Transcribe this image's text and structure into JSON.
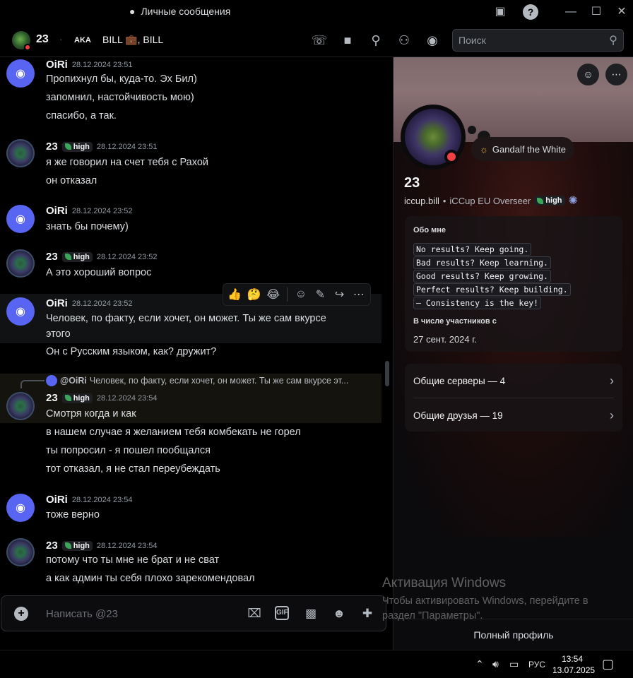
{
  "window": {
    "title": "Личные сообщения"
  },
  "header": {
    "name": "23",
    "aka_label": "AKA",
    "nicknames": "BILL 💼, BILL"
  },
  "search": {
    "placeholder": "Поиск"
  },
  "messages": [
    {
      "author": "OiRi",
      "time": "28.12.2024 23:51",
      "lines": [
        "Пропихнул бы, куда-то. Эх Бил)",
        "запомнил, настойчивость мою)",
        "спасибо, а так."
      ]
    },
    {
      "author": "23",
      "tag": "high",
      "time": "28.12.2024 23:51",
      "lines": [
        "я же говорил на счет тебя с Рахой",
        "он отказал"
      ]
    },
    {
      "author": "OiRi",
      "time": "28.12.2024 23:52",
      "lines": [
        "знать бы почему)"
      ]
    },
    {
      "author": "23",
      "tag": "high",
      "time": "28.12.2024 23:52",
      "lines": [
        "А это хороший вопрос"
      ]
    },
    {
      "author": "OiRi",
      "time": "28.12.2024 23:52",
      "lines": [
        "Человек, по факту, если хочет, он может. Ты же сам вкурсе",
        "этого",
        "Он с Русским языком, как? дружит?"
      ]
    },
    {
      "author": "23",
      "tag": "high",
      "time": "28.12.2024 23:54",
      "reply_to": "@OiRi",
      "reply_text": "Человек, по факту, если хочет, он может. Ты же сам вкурсе эт...",
      "lines": [
        "Смотря когда и как",
        "в нашем случае я желанием тебя комбекать не горел",
        "ты попросил - я пошел пообщался",
        "тот отказал, я не стал переубеждать"
      ]
    },
    {
      "author": "OiRi",
      "time": "28.12.2024 23:54",
      "lines": [
        "тоже верно"
      ]
    },
    {
      "author": "23",
      "tag": "high",
      "time": "28.12.2024 23:54",
      "lines": [
        "потому что ты мне не брат и не сват",
        "а как админ ты себя плохо зарекомендовал"
      ]
    }
  ],
  "composer": {
    "placeholder": "Написать @23"
  },
  "profile": {
    "status": "Gandalf the White",
    "name": "23",
    "username": "iccup.bill",
    "tagline": "iCCup EU Overseer",
    "tag": "high",
    "about_heading": "Обо мне",
    "about_lines": [
      "No results? Keep going.",
      "Bad results? Keep learning.",
      "Good results? Keep growing.",
      "Perfect results? Keep building.",
      "— Consistency is the key!"
    ],
    "member_since_heading": "В числе участников с",
    "member_since": "27 сент. 2024 г.",
    "mutual_servers": "Общие серверы — 4",
    "mutual_friends": "Общие друзья — 19",
    "full_profile": "Полный профиль"
  },
  "watermark": {
    "title": "Активация Windows",
    "line1": "Чтобы активировать Windows, перейдите в",
    "line2": "раздел \"Параметры\"."
  },
  "taskbar": {
    "lang": "РУС",
    "time": "13:54",
    "date": "13.07.2025"
  },
  "colors": {
    "discord_blurple": "#5865f2",
    "status_dnd": "#f23f43",
    "background": "#000000"
  }
}
